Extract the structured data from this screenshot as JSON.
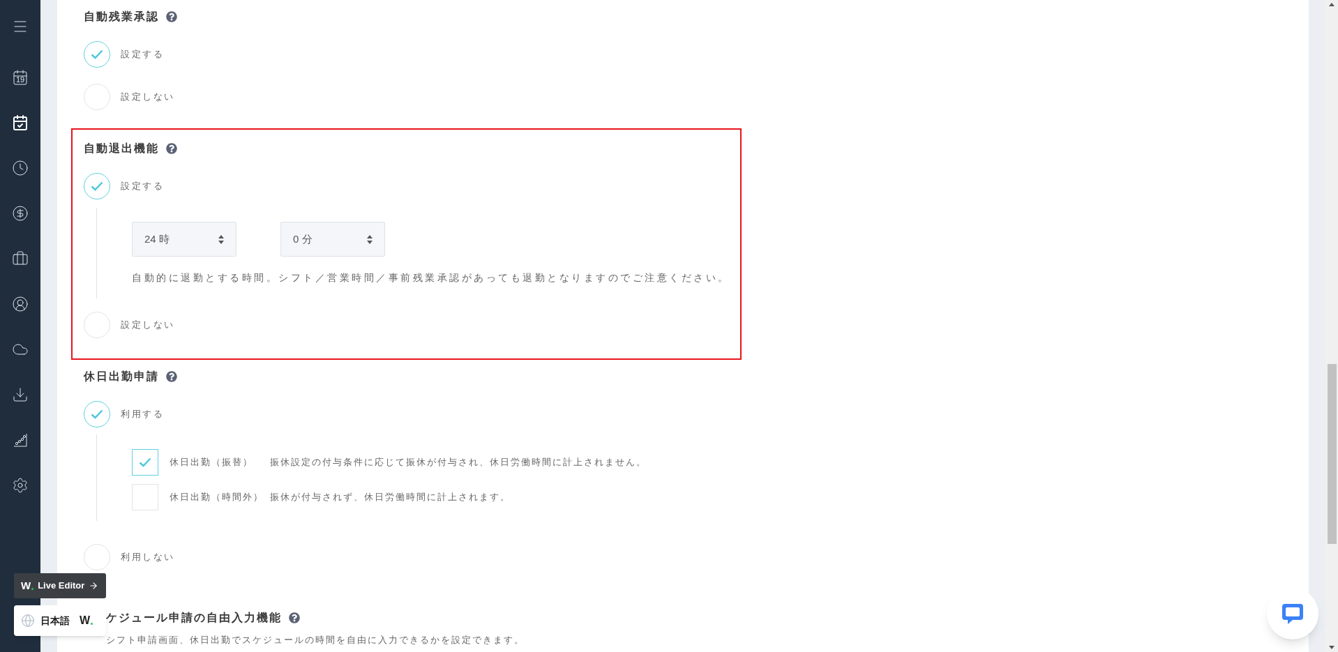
{
  "sidebar": {
    "items": [
      {
        "selected": false
      },
      {
        "selected": false,
        "date": "19"
      },
      {
        "selected": true
      },
      {
        "selected": false
      },
      {
        "selected": false
      },
      {
        "selected": false
      },
      {
        "selected": false
      },
      {
        "selected": false
      },
      {
        "selected": false
      },
      {
        "selected": false
      },
      {
        "selected": false
      }
    ]
  },
  "sections": [
    {
      "title": "自動残業承認",
      "options": [
        {
          "label": "設定する",
          "selected": true
        },
        {
          "label": "設定しない",
          "selected": false
        }
      ]
    },
    {
      "title": "自動退出機能",
      "highlighted": true,
      "options": [
        {
          "label": "設定する",
          "selected": true,
          "detail": {
            "kind": "time",
            "selects": [
              {
                "value": "24 時"
              },
              {
                "value": "0 分"
              }
            ],
            "note": "自動的に退勤とする時間。シフト／営業時間／事前残業承認があっても退勤となりますのでご注意ください。"
          }
        },
        {
          "label": "設定しない",
          "selected": false
        }
      ]
    },
    {
      "title": "休日出勤申請",
      "options": [
        {
          "label": "利用する",
          "selected": true,
          "detail": {
            "kind": "checks",
            "items": [
              {
                "label": "休日出勤（振替）",
                "description": "振休設定の付与条件に応じて振休が付与され、休日労働時間に計上されません。",
                "checked": true
              },
              {
                "label": "休日出勤（時間外）",
                "description": "振休が付与されず、休日労働時間に計上されます。",
                "checked": false
              }
            ]
          }
        },
        {
          "label": "利用しない",
          "selected": false
        }
      ]
    },
    {
      "title": "ケジュール申請の自由入力機能",
      "description": "シフト申請画面、休日出勤でスケジュールの時間を自由に入力できるかを設定できます。"
    }
  ],
  "live_editor": {
    "logo": "W",
    "label": "Live Editor"
  },
  "language": {
    "label": "日本語",
    "logo": "W"
  }
}
